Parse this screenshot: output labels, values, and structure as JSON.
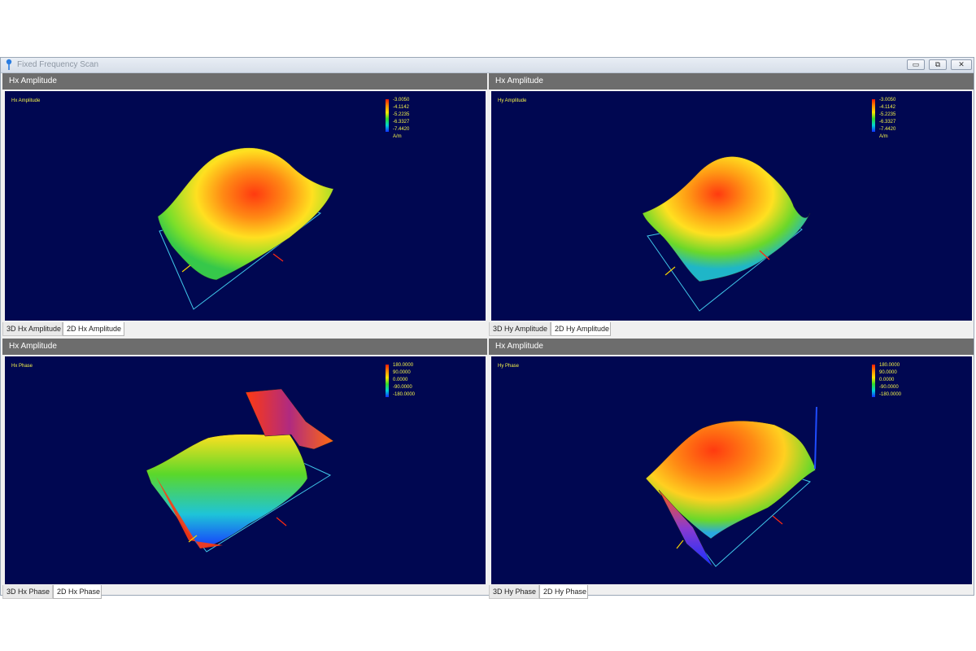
{
  "window": {
    "title": "Fixed Frequency Scan",
    "minimize_glyph": "▭",
    "restore_glyph": "⧉",
    "close_glyph": "✕"
  },
  "panels": [
    {
      "header": "Hx Amplitude",
      "plot_title": "Hx Amplitude",
      "legend": [
        "-3.0050",
        "-4.1142",
        "-5.2235",
        "-6.3327",
        "-7.4420",
        "A/m"
      ],
      "tabs": [
        "3D Hx Amplitude",
        "2D Hx Amplitude"
      ],
      "active_tab": 1
    },
    {
      "header": "Hx Amplitude",
      "plot_title": "Hy Amplitude",
      "legend": [
        "-3.0050",
        "-4.1142",
        "-5.2235",
        "-6.3327",
        "-7.4420",
        "A/m"
      ],
      "tabs": [
        "3D Hy Amplitude",
        "2D Hy Amplitude"
      ],
      "active_tab": 1
    },
    {
      "header": "Hx Amplitude",
      "plot_title": "Hx Phase",
      "legend": [
        "180.0000",
        "90.0000",
        "0.0000",
        "-90.0000",
        "-180.0000"
      ],
      "tabs": [
        "3D Hx Phase",
        "2D Hx Phase"
      ],
      "active_tab": 1
    },
    {
      "header": "Hx Amplitude",
      "plot_title": "Hy Phase",
      "legend": [
        "180.0000",
        "90.0000",
        "0.0000",
        "-90.0000",
        "-180.0000"
      ],
      "tabs": [
        "3D Hy Phase",
        "2D Hy Phase"
      ],
      "active_tab": 1
    }
  ],
  "colors": {
    "plot_background": "#000751",
    "header_background": "#6d6d6d",
    "label_yellow": "#f4f24a",
    "grid_cyan": "#3fc6e8"
  },
  "icons": {
    "app": "pin-icon",
    "minimize": "minimize-icon",
    "restore": "restore-icon",
    "close": "close-icon"
  }
}
